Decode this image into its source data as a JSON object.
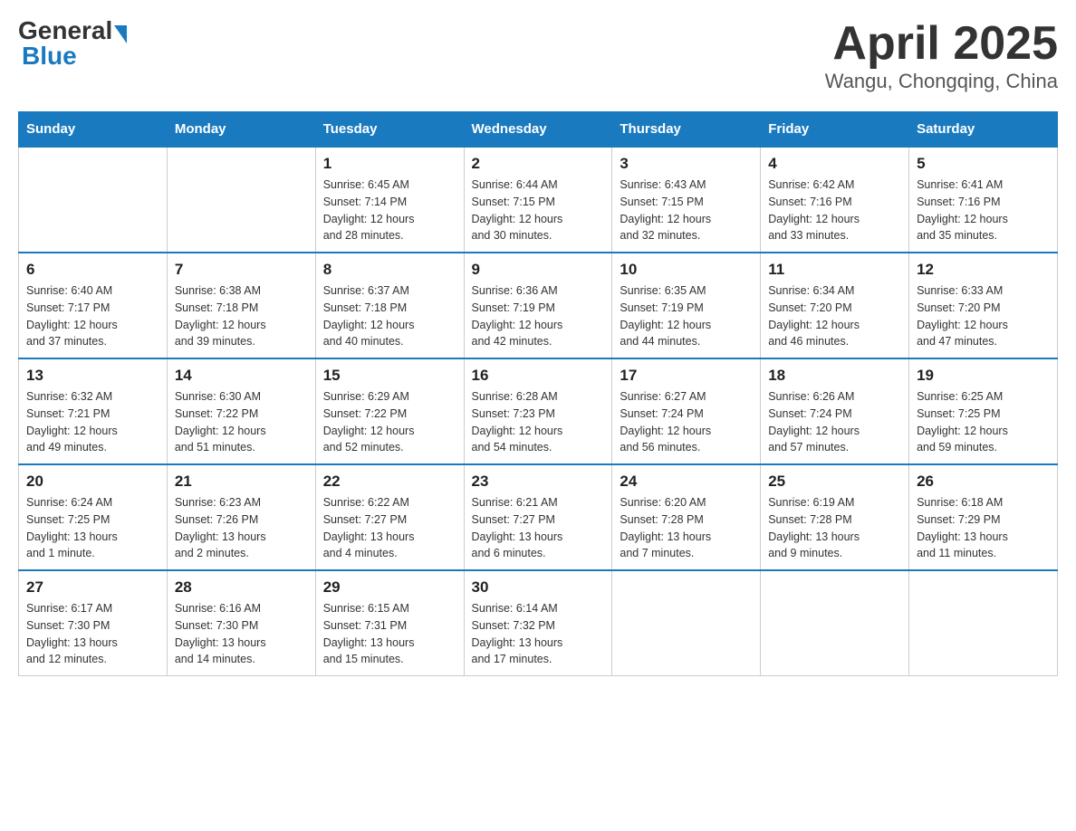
{
  "header": {
    "logo_text_general": "General",
    "logo_text_blue": "Blue",
    "title": "April 2025",
    "subtitle": "Wangu, Chongqing, China"
  },
  "calendar": {
    "days_of_week": [
      "Sunday",
      "Monday",
      "Tuesday",
      "Wednesday",
      "Thursday",
      "Friday",
      "Saturday"
    ],
    "weeks": [
      [
        {
          "day": "",
          "info": ""
        },
        {
          "day": "",
          "info": ""
        },
        {
          "day": "1",
          "info": "Sunrise: 6:45 AM\nSunset: 7:14 PM\nDaylight: 12 hours\nand 28 minutes."
        },
        {
          "day": "2",
          "info": "Sunrise: 6:44 AM\nSunset: 7:15 PM\nDaylight: 12 hours\nand 30 minutes."
        },
        {
          "day": "3",
          "info": "Sunrise: 6:43 AM\nSunset: 7:15 PM\nDaylight: 12 hours\nand 32 minutes."
        },
        {
          "day": "4",
          "info": "Sunrise: 6:42 AM\nSunset: 7:16 PM\nDaylight: 12 hours\nand 33 minutes."
        },
        {
          "day": "5",
          "info": "Sunrise: 6:41 AM\nSunset: 7:16 PM\nDaylight: 12 hours\nand 35 minutes."
        }
      ],
      [
        {
          "day": "6",
          "info": "Sunrise: 6:40 AM\nSunset: 7:17 PM\nDaylight: 12 hours\nand 37 minutes."
        },
        {
          "day": "7",
          "info": "Sunrise: 6:38 AM\nSunset: 7:18 PM\nDaylight: 12 hours\nand 39 minutes."
        },
        {
          "day": "8",
          "info": "Sunrise: 6:37 AM\nSunset: 7:18 PM\nDaylight: 12 hours\nand 40 minutes."
        },
        {
          "day": "9",
          "info": "Sunrise: 6:36 AM\nSunset: 7:19 PM\nDaylight: 12 hours\nand 42 minutes."
        },
        {
          "day": "10",
          "info": "Sunrise: 6:35 AM\nSunset: 7:19 PM\nDaylight: 12 hours\nand 44 minutes."
        },
        {
          "day": "11",
          "info": "Sunrise: 6:34 AM\nSunset: 7:20 PM\nDaylight: 12 hours\nand 46 minutes."
        },
        {
          "day": "12",
          "info": "Sunrise: 6:33 AM\nSunset: 7:20 PM\nDaylight: 12 hours\nand 47 minutes."
        }
      ],
      [
        {
          "day": "13",
          "info": "Sunrise: 6:32 AM\nSunset: 7:21 PM\nDaylight: 12 hours\nand 49 minutes."
        },
        {
          "day": "14",
          "info": "Sunrise: 6:30 AM\nSunset: 7:22 PM\nDaylight: 12 hours\nand 51 minutes."
        },
        {
          "day": "15",
          "info": "Sunrise: 6:29 AM\nSunset: 7:22 PM\nDaylight: 12 hours\nand 52 minutes."
        },
        {
          "day": "16",
          "info": "Sunrise: 6:28 AM\nSunset: 7:23 PM\nDaylight: 12 hours\nand 54 minutes."
        },
        {
          "day": "17",
          "info": "Sunrise: 6:27 AM\nSunset: 7:24 PM\nDaylight: 12 hours\nand 56 minutes."
        },
        {
          "day": "18",
          "info": "Sunrise: 6:26 AM\nSunset: 7:24 PM\nDaylight: 12 hours\nand 57 minutes."
        },
        {
          "day": "19",
          "info": "Sunrise: 6:25 AM\nSunset: 7:25 PM\nDaylight: 12 hours\nand 59 minutes."
        }
      ],
      [
        {
          "day": "20",
          "info": "Sunrise: 6:24 AM\nSunset: 7:25 PM\nDaylight: 13 hours\nand 1 minute."
        },
        {
          "day": "21",
          "info": "Sunrise: 6:23 AM\nSunset: 7:26 PM\nDaylight: 13 hours\nand 2 minutes."
        },
        {
          "day": "22",
          "info": "Sunrise: 6:22 AM\nSunset: 7:27 PM\nDaylight: 13 hours\nand 4 minutes."
        },
        {
          "day": "23",
          "info": "Sunrise: 6:21 AM\nSunset: 7:27 PM\nDaylight: 13 hours\nand 6 minutes."
        },
        {
          "day": "24",
          "info": "Sunrise: 6:20 AM\nSunset: 7:28 PM\nDaylight: 13 hours\nand 7 minutes."
        },
        {
          "day": "25",
          "info": "Sunrise: 6:19 AM\nSunset: 7:28 PM\nDaylight: 13 hours\nand 9 minutes."
        },
        {
          "day": "26",
          "info": "Sunrise: 6:18 AM\nSunset: 7:29 PM\nDaylight: 13 hours\nand 11 minutes."
        }
      ],
      [
        {
          "day": "27",
          "info": "Sunrise: 6:17 AM\nSunset: 7:30 PM\nDaylight: 13 hours\nand 12 minutes."
        },
        {
          "day": "28",
          "info": "Sunrise: 6:16 AM\nSunset: 7:30 PM\nDaylight: 13 hours\nand 14 minutes."
        },
        {
          "day": "29",
          "info": "Sunrise: 6:15 AM\nSunset: 7:31 PM\nDaylight: 13 hours\nand 15 minutes."
        },
        {
          "day": "30",
          "info": "Sunrise: 6:14 AM\nSunset: 7:32 PM\nDaylight: 13 hours\nand 17 minutes."
        },
        {
          "day": "",
          "info": ""
        },
        {
          "day": "",
          "info": ""
        },
        {
          "day": "",
          "info": ""
        }
      ]
    ]
  }
}
